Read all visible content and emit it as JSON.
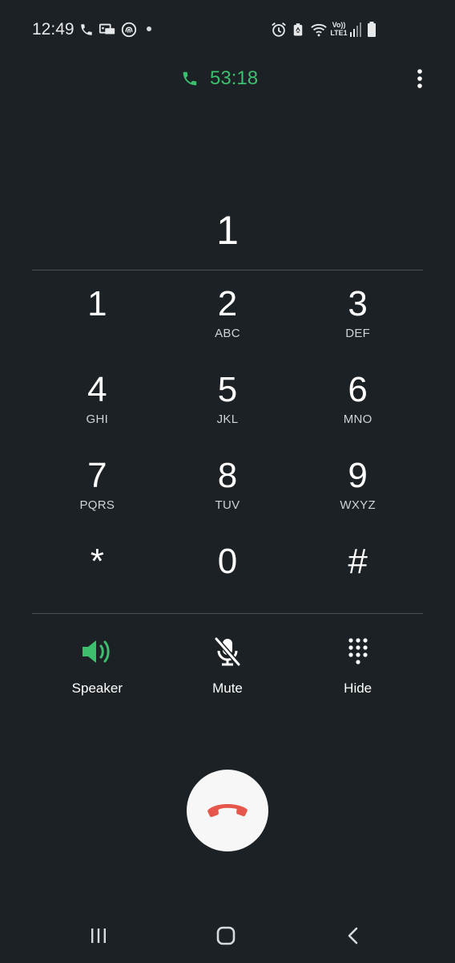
{
  "status_bar": {
    "time": "12:49",
    "left_icons": [
      "phone-call-icon",
      "voicemail-screen-icon",
      "fingerprint-icon",
      "notification-dot-icon"
    ],
    "right_icons": [
      "alarm-icon",
      "battery-saver-icon",
      "wifi-icon",
      "volte-lte-icon",
      "signal-icon",
      "battery-icon"
    ],
    "volte_label": "Vo))",
    "lte_label": "LTE1"
  },
  "header": {
    "call_duration": "53:18",
    "accent_color": "#3dbf6e",
    "more_icon": "more-vertical-icon"
  },
  "dialed_number": "1",
  "keypad": [
    {
      "digit": "1",
      "letters": ""
    },
    {
      "digit": "2",
      "letters": "ABC"
    },
    {
      "digit": "3",
      "letters": "DEF"
    },
    {
      "digit": "4",
      "letters": "GHI"
    },
    {
      "digit": "5",
      "letters": "JKL"
    },
    {
      "digit": "6",
      "letters": "MNO"
    },
    {
      "digit": "7",
      "letters": "PQRS"
    },
    {
      "digit": "8",
      "letters": "TUV"
    },
    {
      "digit": "9",
      "letters": "WXYZ"
    },
    {
      "digit": "*",
      "letters": ""
    },
    {
      "digit": "0",
      "letters": ""
    },
    {
      "digit": "#",
      "letters": ""
    }
  ],
  "actions": {
    "speaker": {
      "label": "Speaker",
      "icon": "speaker-icon",
      "active": true
    },
    "mute": {
      "label": "Mute",
      "icon": "mute-mic-icon",
      "active": false
    },
    "hide": {
      "label": "Hide",
      "icon": "keypad-icon",
      "active": false
    }
  },
  "end_call": {
    "icon": "end-call-icon",
    "color": "#e5574b"
  },
  "nav_bar": {
    "icons": [
      "recent-apps-icon",
      "home-icon",
      "back-icon"
    ]
  }
}
